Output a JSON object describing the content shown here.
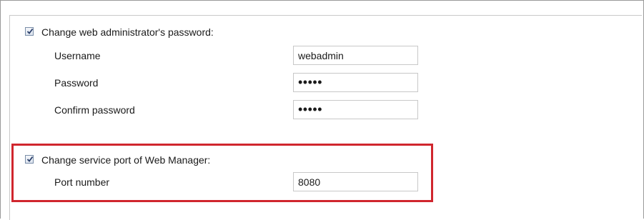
{
  "admin_section": {
    "title": "Change web administrator's password:",
    "checked": true,
    "username_label": "Username",
    "username_value": "webadmin",
    "password_label": "Password",
    "password_mask": "•••••",
    "confirm_label": "Confirm password",
    "confirm_mask": "•••••"
  },
  "port_section": {
    "title": "Change service port of Web Manager:",
    "checked": true,
    "port_label": "Port number",
    "port_value": "8080"
  },
  "colors": {
    "highlight": "#d0262e",
    "checkbox_border": "#7a8ea8"
  },
  "icons": {
    "check": "checkmark-icon"
  }
}
